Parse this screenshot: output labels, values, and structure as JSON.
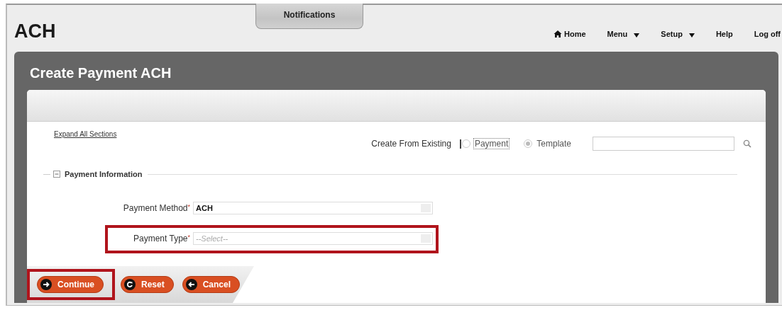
{
  "header": {
    "title": "ACH",
    "notifications_tab": "Notifications"
  },
  "nav": [
    {
      "label": "Home",
      "kind": "home"
    },
    {
      "label": "Menu",
      "kind": "dropdown"
    },
    {
      "label": "Setup",
      "kind": "dropdown"
    },
    {
      "label": "Help",
      "kind": "plain"
    },
    {
      "label": "Log off",
      "kind": "plain"
    }
  ],
  "page": {
    "title": "Create Payment ACH"
  },
  "expand_link": "Expand All Sections",
  "create_from": {
    "label": "Create From Existing",
    "options": [
      {
        "label": "Payment",
        "selected": false,
        "focused": true
      },
      {
        "label": "Template",
        "selected": true,
        "focused": false
      }
    ]
  },
  "section": {
    "title": "Payment Information",
    "expanded": true
  },
  "fields": [
    {
      "label": "Payment Method",
      "required_mark": "*",
      "value": "ACH",
      "highlighted": false
    },
    {
      "label": "Payment Type",
      "required_mark": "*",
      "placeholder": "--Select--",
      "highlighted": true
    }
  ],
  "buttons": [
    {
      "label": "Continue",
      "kind": "continue",
      "highlighted": true
    },
    {
      "label": "Reset",
      "kind": "reset",
      "highlighted": false
    },
    {
      "label": "Cancel",
      "kind": "cancel",
      "highlighted": false
    }
  ]
}
